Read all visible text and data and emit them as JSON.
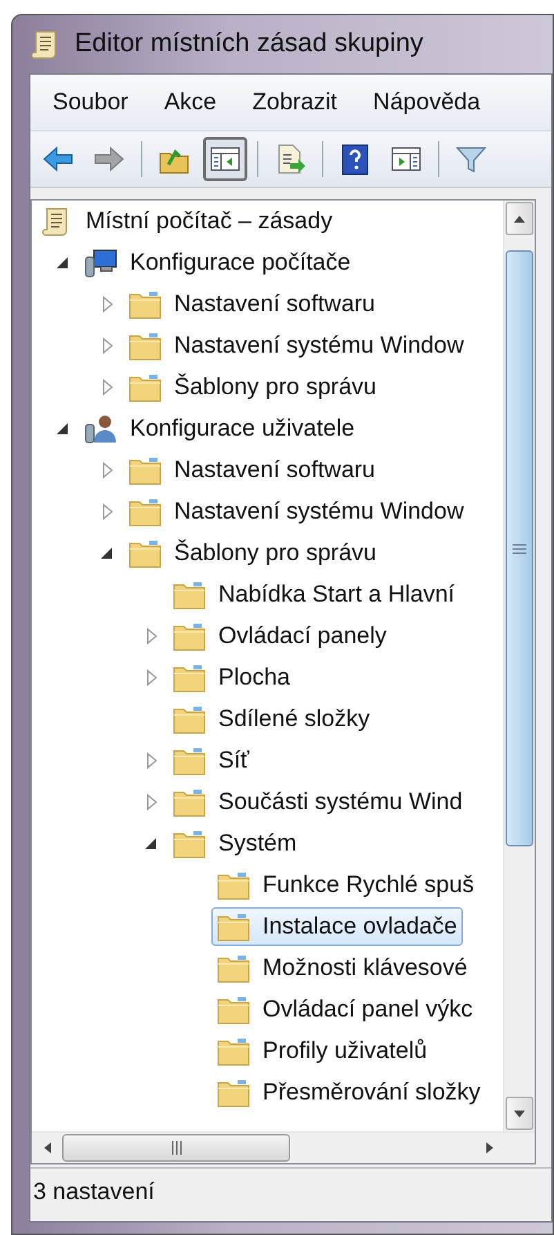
{
  "window": {
    "title": "Editor místních zásad skupiny"
  },
  "menu": [
    "Soubor",
    "Akce",
    "Zobrazit",
    "Nápověda"
  ],
  "toolbar": [
    [
      {
        "kind": "back",
        "pressed": false,
        "disabled": false
      },
      {
        "kind": "forward",
        "pressed": false,
        "disabled": true
      }
    ],
    [
      {
        "kind": "up",
        "pressed": false,
        "disabled": false
      },
      {
        "kind": "toggle-tree",
        "pressed": true,
        "disabled": false
      }
    ],
    [
      {
        "kind": "export",
        "pressed": false,
        "disabled": false
      }
    ],
    [
      {
        "kind": "help",
        "pressed": false,
        "disabled": false
      },
      {
        "kind": "toggle-actions",
        "pressed": false,
        "disabled": false
      }
    ],
    [
      {
        "kind": "filter",
        "pressed": false,
        "disabled": false
      }
    ]
  ],
  "tree": [
    {
      "label": "Místní počítač – zásady",
      "kind": "policy",
      "selected": false,
      "children": [
        {
          "label": "Konfigurace počítače",
          "kind": "computer",
          "expandable": true,
          "expanded": true,
          "selected": false,
          "children": [
            {
              "label": "Nastavení softwaru",
              "kind": "folder",
              "expandable": true,
              "expanded": false,
              "selected": false
            },
            {
              "label": "Nastavení systému Window",
              "kind": "folder",
              "expandable": true,
              "expanded": false,
              "selected": false
            },
            {
              "label": "Šablony pro správu",
              "kind": "folder",
              "expandable": true,
              "expanded": false,
              "selected": false
            }
          ]
        },
        {
          "label": "Konfigurace uživatele",
          "kind": "user",
          "expandable": true,
          "expanded": true,
          "selected": false,
          "children": [
            {
              "label": "Nastavení softwaru",
              "kind": "folder",
              "expandable": true,
              "expanded": false,
              "selected": false
            },
            {
              "label": "Nastavení systému Window",
              "kind": "folder",
              "expandable": true,
              "expanded": false,
              "selected": false
            },
            {
              "label": "Šablony pro správu",
              "kind": "folder",
              "expandable": true,
              "expanded": true,
              "selected": false,
              "children": [
                {
                  "label": "Nabídka Start a Hlavní",
                  "kind": "folder",
                  "expandable": false,
                  "selected": false
                },
                {
                  "label": "Ovládací panely",
                  "kind": "folder",
                  "expandable": true,
                  "expanded": false,
                  "selected": false
                },
                {
                  "label": "Plocha",
                  "kind": "folder",
                  "expandable": true,
                  "expanded": false,
                  "selected": false
                },
                {
                  "label": "Sdílené složky",
                  "kind": "folder",
                  "expandable": false,
                  "selected": false
                },
                {
                  "label": "Síť",
                  "kind": "folder",
                  "expandable": true,
                  "expanded": false,
                  "selected": false
                },
                {
                  "label": "Součásti systému Wind",
                  "kind": "folder",
                  "expandable": true,
                  "expanded": false,
                  "selected": false
                },
                {
                  "label": "Systém",
                  "kind": "folder",
                  "expandable": true,
                  "expanded": true,
                  "selected": false,
                  "children": [
                    {
                      "label": "Funkce Rychlé spuš",
                      "kind": "folder",
                      "expandable": false,
                      "selected": false
                    },
                    {
                      "label": "Instalace ovladače",
                      "kind": "folder",
                      "expandable": false,
                      "selected": true
                    },
                    {
                      "label": "Možnosti klávesové",
                      "kind": "folder",
                      "expandable": false,
                      "selected": false
                    },
                    {
                      "label": "Ovládací panel výkc",
                      "kind": "folder",
                      "expandable": false,
                      "selected": false
                    },
                    {
                      "label": "Profily uživatelů",
                      "kind": "folder",
                      "expandable": false,
                      "selected": false
                    },
                    {
                      "label": "Přesměrování složky",
                      "kind": "folder",
                      "expandable": false,
                      "selected": false
                    }
                  ]
                }
              ]
            }
          ]
        }
      ]
    }
  ],
  "status_bar": "3 nastavení"
}
